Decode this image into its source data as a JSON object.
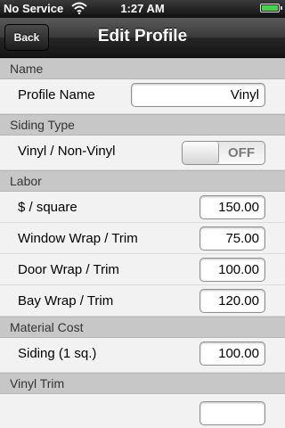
{
  "status_bar": {
    "carrier": "No Service",
    "time": "1:27 AM"
  },
  "nav": {
    "back_label": "Back",
    "title": "Edit Profile"
  },
  "sections": {
    "name": {
      "header": "Name",
      "profile_name_label": "Profile Name",
      "profile_name_value": "Vinyl"
    },
    "siding_type": {
      "header": "Siding Type",
      "toggle_label": "Vinyl / Non-Vinyl",
      "toggle_state": "OFF"
    },
    "labor": {
      "header": "Labor",
      "rows": [
        {
          "label": "$ / square",
          "value": "150.00"
        },
        {
          "label": "Window Wrap / Trim",
          "value": "75.00"
        },
        {
          "label": "Door Wrap / Trim",
          "value": "100.00"
        },
        {
          "label": "Bay Wrap / Trim",
          "value": "120.00"
        }
      ]
    },
    "material_cost": {
      "header": "Material Cost",
      "rows": [
        {
          "label": "Siding (1 sq.)",
          "value": "100.00"
        }
      ]
    },
    "vinyl_trim": {
      "header": "Vinyl Trim"
    }
  }
}
